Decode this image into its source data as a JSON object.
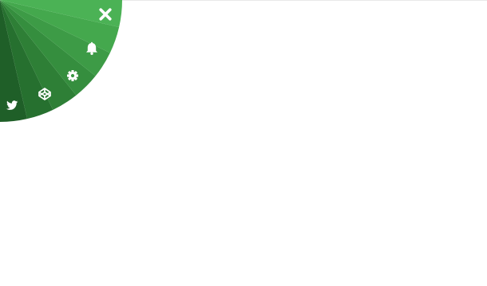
{
  "radial_menu": {
    "colors": {
      "wedges": [
        "#1f5f28",
        "#26702f",
        "#2e7f36",
        "#358e3e",
        "#3d9b46",
        "#44a84d",
        "#4bb255"
      ],
      "icon": "#ffffff"
    },
    "items": [
      {
        "icon": "twitter-icon"
      },
      {
        "icon": "codepen-icon"
      },
      {
        "icon": "gear-icon"
      },
      {
        "icon": "bell-icon"
      },
      {
        "icon": "close-icon"
      }
    ]
  }
}
